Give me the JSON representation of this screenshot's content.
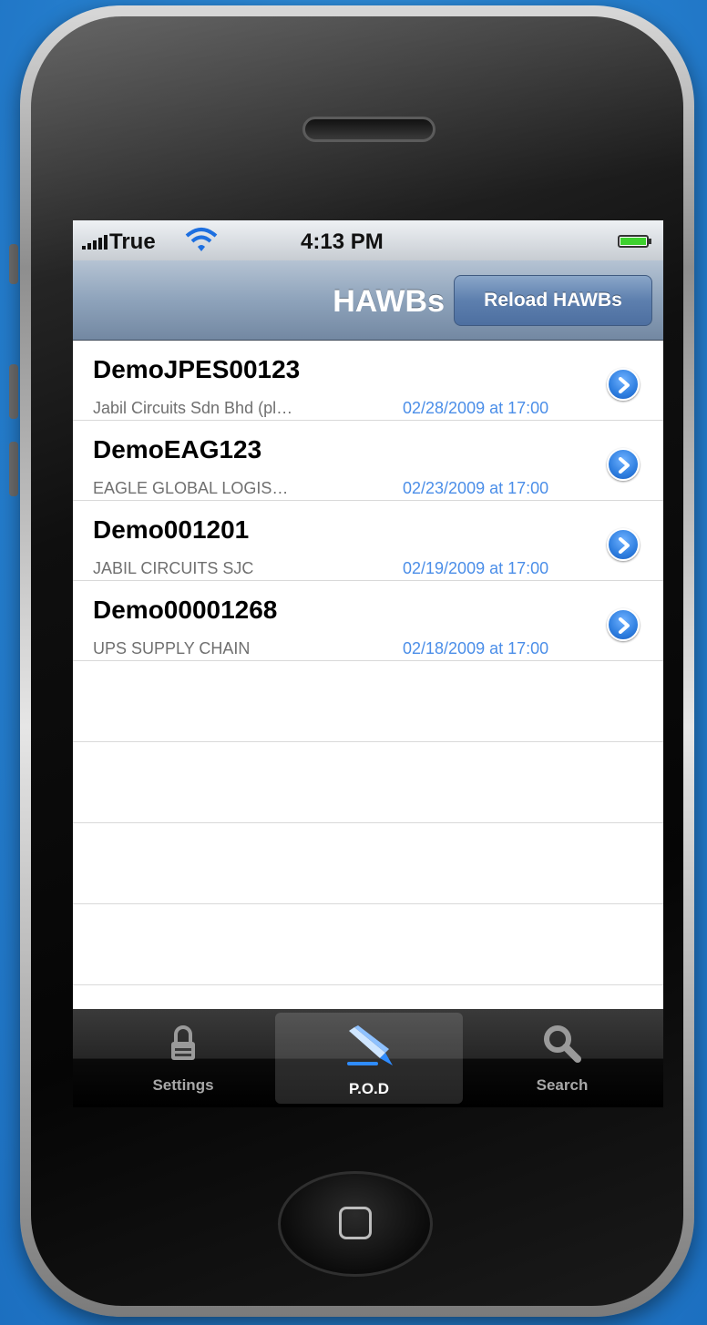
{
  "status_bar": {
    "carrier": "True",
    "time": "4:13 PM"
  },
  "nav": {
    "title": "HAWBs",
    "reload_label": "Reload HAWBs"
  },
  "hawbs": [
    {
      "title": "DemoJPES00123",
      "subtitle": "Jabil Circuits Sdn Bhd (pl…",
      "date": "02/28/2009 at 17:00"
    },
    {
      "title": "DemoEAG123",
      "subtitle": "EAGLE GLOBAL LOGIS…",
      "date": "02/23/2009 at 17:00"
    },
    {
      "title": "Demo001201",
      "subtitle": "JABIL CIRCUITS SJC",
      "date": "02/19/2009 at 17:00"
    },
    {
      "title": "Demo00001268",
      "subtitle": "UPS SUPPLY CHAIN",
      "date": "02/18/2009 at 17:00"
    }
  ],
  "tabbar": {
    "selected": "P.O.D",
    "tabs": [
      {
        "label": "Settings",
        "icon": "lock-icon"
      },
      {
        "label": "P.O.D",
        "icon": "pen-icon"
      },
      {
        "label": "Search",
        "icon": "magnifier-icon"
      }
    ]
  },
  "colors": {
    "background": "#2a86d4",
    "nav_bar": "#8ea3bb",
    "date_text": "#4b8ee8",
    "disclosure": "#2f7fe0"
  }
}
